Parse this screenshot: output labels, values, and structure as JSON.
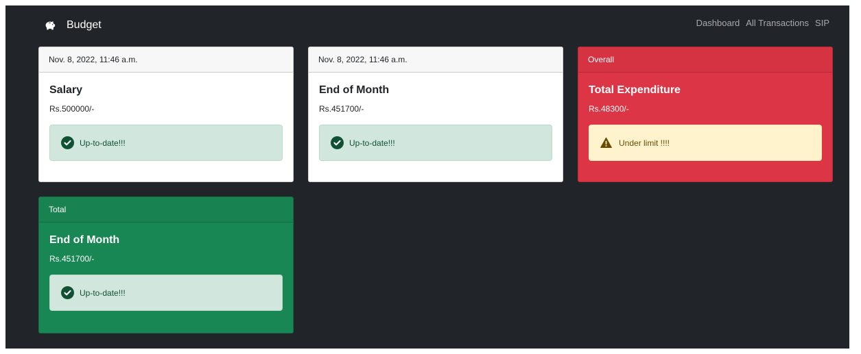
{
  "navbar": {
    "brand": "Budget",
    "brand_icon": "piggy-bank-icon",
    "links": [
      "Dashboard",
      "All Transactions",
      "SIP"
    ]
  },
  "cards": [
    {
      "header": "Nov. 8, 2022, 11:46 a.m.",
      "title": "Salary",
      "amount": "Rs.500000/-",
      "alert": {
        "text": "Up-to-date!!!",
        "icon": "check-circle-icon",
        "type": "success"
      }
    },
    {
      "header": "Nov. 8, 2022, 11:46 a.m.",
      "title": "End of Month",
      "amount": "Rs.451700/-",
      "alert": {
        "text": "Up-to-date!!!",
        "icon": "check-circle-icon",
        "type": "success"
      }
    },
    {
      "header": "Overall",
      "title": "Total Expenditure",
      "amount": "Rs.48300/-",
      "alert": {
        "text": "Under limit !!!!",
        "icon": "warning-triangle-icon",
        "type": "warning"
      }
    },
    {
      "header": "Total",
      "title": "End of Month",
      "amount": "Rs.451700/-",
      "alert": {
        "text": "Up-to-date!!!",
        "icon": "check-circle-icon",
        "type": "success"
      }
    }
  ],
  "colors": {
    "background": "#212529",
    "danger": "#dc3545",
    "success": "#198754",
    "alert_success_bg": "#d1e7dd",
    "alert_warning_bg": "#fff3cd"
  }
}
